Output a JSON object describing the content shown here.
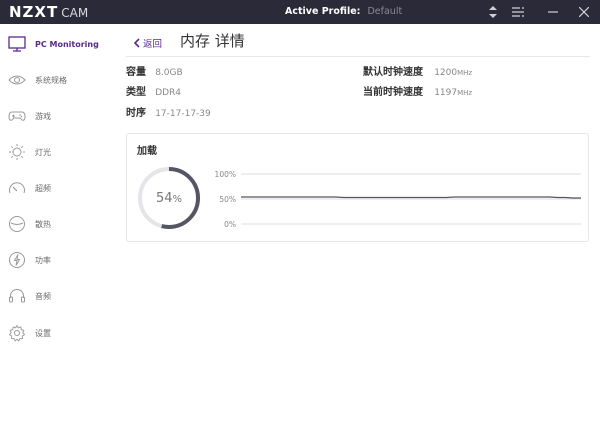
{
  "app": {
    "logo_main": "NZXT",
    "logo_sub": "CAM",
    "active_profile_label": "Active Profile:",
    "active_profile_value": "Default"
  },
  "sidebar": {
    "items": [
      {
        "label": "PC Monitoring",
        "icon": "monitor-icon",
        "active": true
      },
      {
        "label": "系统规格",
        "icon": "eye-icon"
      },
      {
        "label": "游戏",
        "icon": "gamepad-icon"
      },
      {
        "label": "灯光",
        "icon": "sun-icon"
      },
      {
        "label": "超频",
        "icon": "speedometer-icon"
      },
      {
        "label": "散热",
        "icon": "fan-icon"
      },
      {
        "label": "功率",
        "icon": "bolt-icon"
      },
      {
        "label": "音频",
        "icon": "headphones-icon"
      },
      {
        "label": "设置",
        "icon": "gear-icon"
      }
    ]
  },
  "main": {
    "back_label": "返回",
    "title": "内存 详情",
    "specs": {
      "capacity": {
        "label": "容量",
        "value": "8.0GB"
      },
      "type": {
        "label": "类型",
        "value": "DDR4"
      },
      "timing": {
        "label": "时序",
        "value": "17-17-17-39"
      },
      "default_clock": {
        "label": "默认时钟速度",
        "value": "1200",
        "unit": "MHz"
      },
      "current_clock": {
        "label": "当前时钟速度",
        "value": "1197",
        "unit": "MHz"
      }
    },
    "load": {
      "title": "加载",
      "value": "54",
      "unit": "%",
      "fraction": 0.54
    }
  },
  "chart_data": {
    "type": "line",
    "y_ticks": [
      "100%",
      "50%",
      "0%"
    ],
    "ylim": [
      0,
      100
    ],
    "series": [
      {
        "values": [
          54,
          54,
          54,
          54,
          54,
          54,
          54,
          54,
          54,
          54,
          54,
          54,
          54,
          53,
          53,
          53,
          53,
          53,
          53,
          53,
          53,
          53,
          53,
          53,
          53,
          53,
          53,
          54,
          54,
          54,
          54,
          54,
          54,
          54,
          54,
          54,
          54,
          54,
          54,
          54,
          53,
          53,
          52,
          52
        ]
      }
    ],
    "colors": {
      "line": "#555566",
      "grid": "#dddddd"
    }
  }
}
